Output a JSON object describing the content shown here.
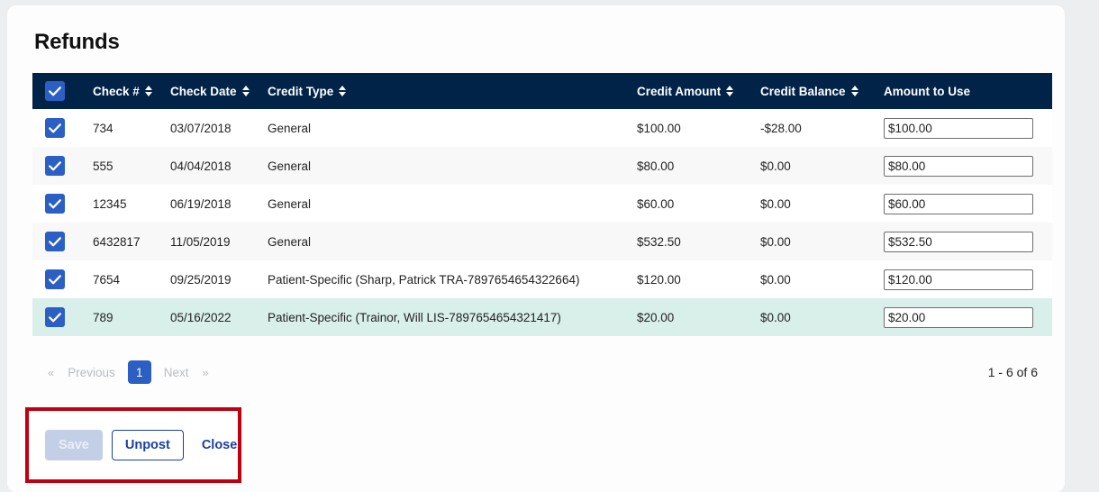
{
  "page": {
    "title": "Refunds"
  },
  "table": {
    "select_all_checked": true,
    "columns": [
      {
        "key": "select",
        "label": "",
        "sortable": false
      },
      {
        "key": "check",
        "label": "Check #",
        "sortable": true
      },
      {
        "key": "date",
        "label": "Check Date",
        "sortable": true
      },
      {
        "key": "type",
        "label": "Credit Type",
        "sortable": true
      },
      {
        "key": "amount",
        "label": "Credit Amount",
        "sortable": true
      },
      {
        "key": "balance",
        "label": "Credit Balance",
        "sortable": true
      },
      {
        "key": "use",
        "label": "Amount to Use",
        "sortable": false
      }
    ],
    "rows": [
      {
        "checked": true,
        "check": "734",
        "date": "03/07/2018",
        "type": "General",
        "amount": "$100.00",
        "balance": "-$28.00",
        "amount_to_use": "$100.00",
        "selected": false
      },
      {
        "checked": true,
        "check": "555",
        "date": "04/04/2018",
        "type": "General",
        "amount": "$80.00",
        "balance": "$0.00",
        "amount_to_use": "$80.00",
        "selected": false
      },
      {
        "checked": true,
        "check": "12345",
        "date": "06/19/2018",
        "type": "General",
        "amount": "$60.00",
        "balance": "$0.00",
        "amount_to_use": "$60.00",
        "selected": false
      },
      {
        "checked": true,
        "check": "6432817",
        "date": "11/05/2019",
        "type": "General",
        "amount": "$532.50",
        "balance": "$0.00",
        "amount_to_use": "$532.50",
        "selected": false
      },
      {
        "checked": true,
        "check": "7654",
        "date": "09/25/2019",
        "type": "Patient-Specific (Sharp, Patrick TRA-7897654654322664)",
        "amount": "$120.00",
        "balance": "$0.00",
        "amount_to_use": "$120.00",
        "selected": false
      },
      {
        "checked": true,
        "check": "789",
        "date": "05/16/2022",
        "type": "Patient-Specific (Trainor, Will LIS-7897654654321417)",
        "amount": "$20.00",
        "balance": "$0.00",
        "amount_to_use": "$20.00",
        "selected": true
      }
    ]
  },
  "pagination": {
    "first_chevron": "«",
    "previous_label": "Previous",
    "current_page": "1",
    "next_label": "Next",
    "last_chevron": "»",
    "record_range": "1 - 6 of 6"
  },
  "actions": {
    "save_label": "Save",
    "save_disabled": true,
    "unpost_label": "Unpost",
    "close_label": "Close",
    "highlight_color": "#c00011"
  },
  "colors": {
    "header_bg": "#012347",
    "accent_blue": "#2b5fc4",
    "link_blue": "#1b3fa0",
    "selected_row": "#d9f0ea",
    "stripe_row": "#f8f8f8",
    "page_bg": "#eceef0"
  }
}
